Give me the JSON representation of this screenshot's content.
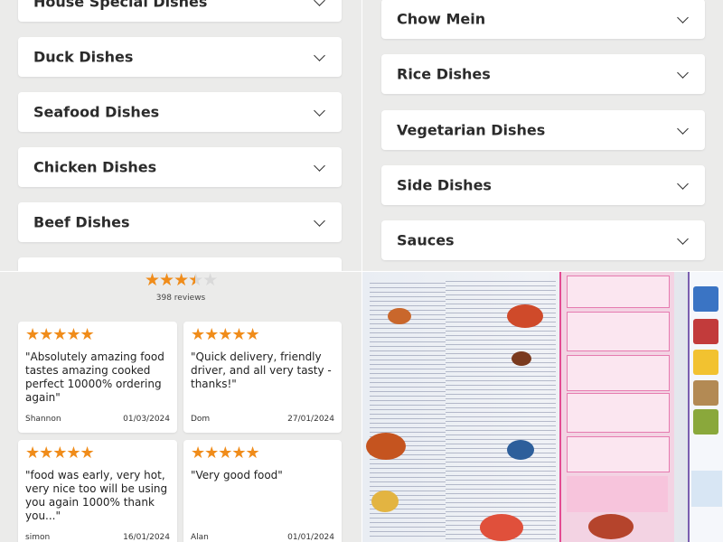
{
  "categories_left": [
    {
      "label": "House Special Dishes"
    },
    {
      "label": "Duck Dishes"
    },
    {
      "label": "Seafood Dishes"
    },
    {
      "label": "Chicken Dishes"
    },
    {
      "label": "Beef Dishes"
    }
  ],
  "categories_right": [
    {
      "label": "Chow Mein"
    },
    {
      "label": "Rice Dishes"
    },
    {
      "label": "Vegetarian Dishes"
    },
    {
      "label": "Side Dishes"
    },
    {
      "label": "Sauces"
    }
  ],
  "rating": {
    "stars_filled": 3.5,
    "stars_total": 5,
    "review_count": "398 reviews"
  },
  "reviews": [
    {
      "stars": 5,
      "text": "\"Absolutely amazing food tastes amazing cooked perfect 10000% ordering again\"",
      "name": "Shannon",
      "date": "01/03/2024"
    },
    {
      "stars": 5,
      "text": "\"Quick delivery, friendly driver, and all very tasty - thanks!\"",
      "name": "Dom",
      "date": "27/01/2024"
    },
    {
      "stars": 5,
      "text": "\"food was early, very hot, very nice too will be using you again 1000% thank you...\"",
      "name": "simon",
      "date": "16/01/2024"
    },
    {
      "stars": 5,
      "text": "\"Very good food\"",
      "name": "Alan",
      "date": "01/01/2024"
    }
  ],
  "colors": {
    "star": "#f08c1a",
    "star_empty": "#d9d9d9",
    "menu_pink": "#e34b92"
  },
  "icons": {
    "chevron": "chevron-down-icon",
    "star": "star-icon"
  }
}
